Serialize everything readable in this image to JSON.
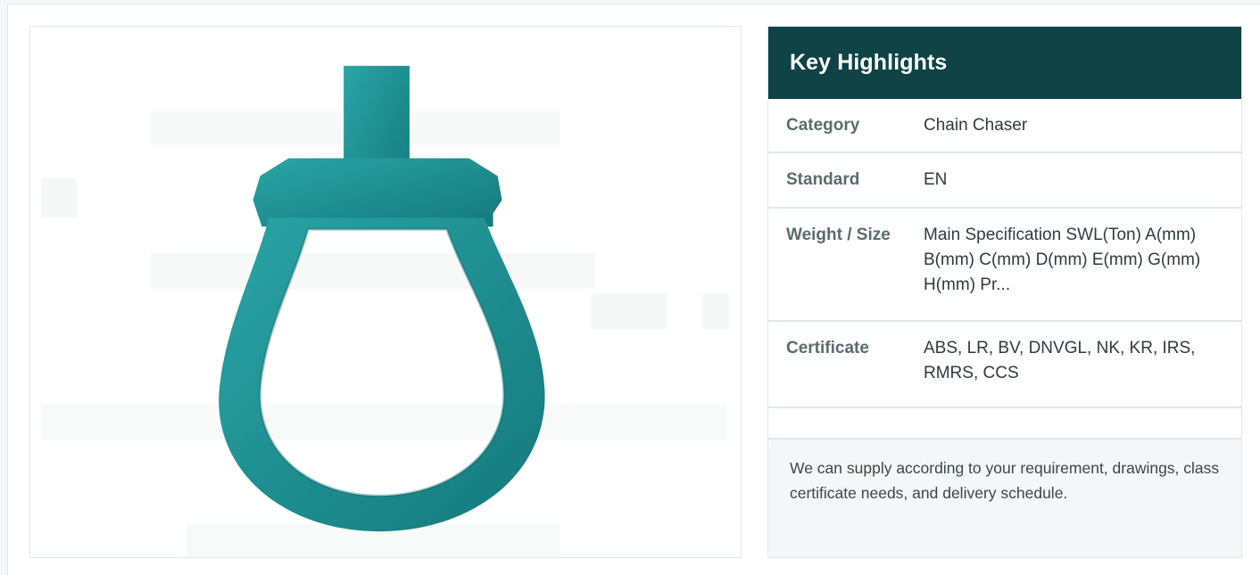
{
  "highlights": {
    "title": "Key Highlights",
    "rows": [
      {
        "label": "Category",
        "value": "Chain Chaser"
      },
      {
        "label": "Standard",
        "value": "EN"
      },
      {
        "label": "Weight / Size",
        "value": "Main Specification SWL(Ton) A(mm) B(mm) C(mm) D(mm) E(mm) G(mm) H(mm) Pr..."
      },
      {
        "label": "Certificate",
        "value": "ABS, LR, BV, DNVGL, NK, KR, IRS, RMRS, CCS"
      }
    ],
    "note": "We can supply according to your requirement, drawings, class certificate needs, and delivery schedule."
  },
  "product_image": {
    "icon": "chain-chaser-icon",
    "color": "#1e9597"
  },
  "colors": {
    "header_bg": "#0f4345",
    "panel_border": "#dfe7ea",
    "note_bg": "#f3f7f8"
  }
}
